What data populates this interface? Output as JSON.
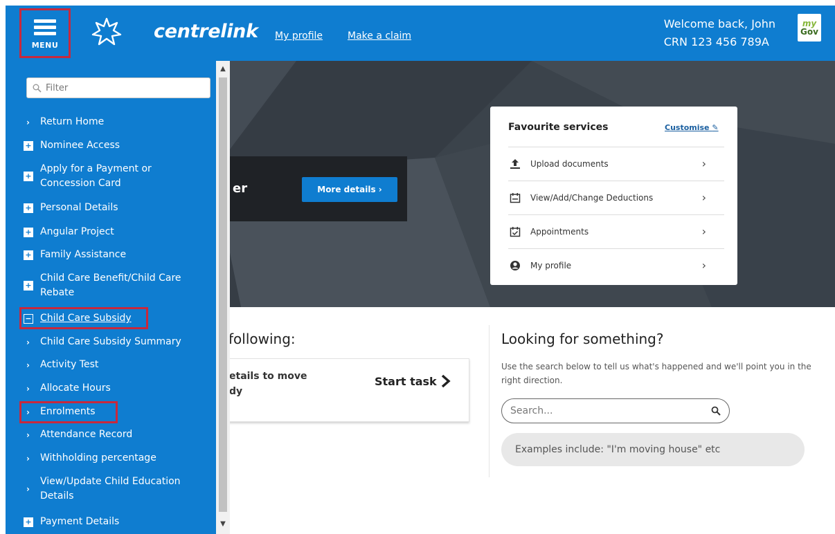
{
  "header": {
    "menu_label": "MENU",
    "brand": "centrelink",
    "links": [
      "My profile",
      "Make a claim"
    ],
    "welcome": "Welcome back, John",
    "crn": "CRN 123 456 789A",
    "mygov_my": "my",
    "mygov_gov": "Gov"
  },
  "hero": {
    "banner_text_fragment": "er",
    "more_details_label": "More details ›"
  },
  "favourites": {
    "title": "Favourite services",
    "customise": "Customise",
    "items": [
      {
        "label": "Upload documents",
        "icon": "upload-icon"
      },
      {
        "label": "View/Add/Change Deductions",
        "icon": "calendar-icon"
      },
      {
        "label": "Appointments",
        "icon": "calendar-check-icon"
      },
      {
        "label": "My profile",
        "icon": "user-circle-icon"
      }
    ]
  },
  "tasks": {
    "heading_fragment": "following:",
    "card_text_line1": "etails to move",
    "card_text_line2": "dy",
    "start_label": "Start task"
  },
  "lookup": {
    "title": "Looking for something?",
    "description": "Use the search below to tell us what's happened and we'll point you in the right direction.",
    "search_placeholder": "Search...",
    "examples": "Examples include: \"I'm moving house\" etc"
  },
  "sidemenu": {
    "filter_placeholder": "Filter",
    "items": [
      {
        "label": "Return Home",
        "type": "arrow"
      },
      {
        "label": "Nominee Access",
        "type": "plus"
      },
      {
        "label": "Apply for a Payment or",
        "label2": "Concession Card",
        "type": "plus"
      },
      {
        "label": "Personal Details",
        "type": "plus"
      },
      {
        "label": "Angular Project",
        "type": "plus"
      },
      {
        "label": "Family Assistance",
        "type": "plus"
      },
      {
        "label": "Child Care Benefit/Child Care",
        "label2": "Rebate",
        "type": "plus"
      },
      {
        "label": "Child Care Subsidy",
        "type": "minus",
        "highlighted": true
      },
      {
        "label": "Child Care Subsidy Summary",
        "type": "arrow"
      },
      {
        "label": "Activity Test",
        "type": "arrow"
      },
      {
        "label": "Allocate Hours",
        "type": "arrow"
      },
      {
        "label": "Enrolments",
        "type": "arrow",
        "highlighted": true
      },
      {
        "label": "Attendance Record",
        "type": "arrow"
      },
      {
        "label": "Withholding percentage",
        "type": "arrow"
      },
      {
        "label": "View/Update Child Education",
        "label2": "Details",
        "type": "arrow"
      },
      {
        "label": "Payment Details",
        "type": "plus"
      }
    ]
  },
  "colors": {
    "brand_blue": "#0f7dd0",
    "highlight_red": "#c8283c",
    "hero_dark": "#3b434b"
  }
}
